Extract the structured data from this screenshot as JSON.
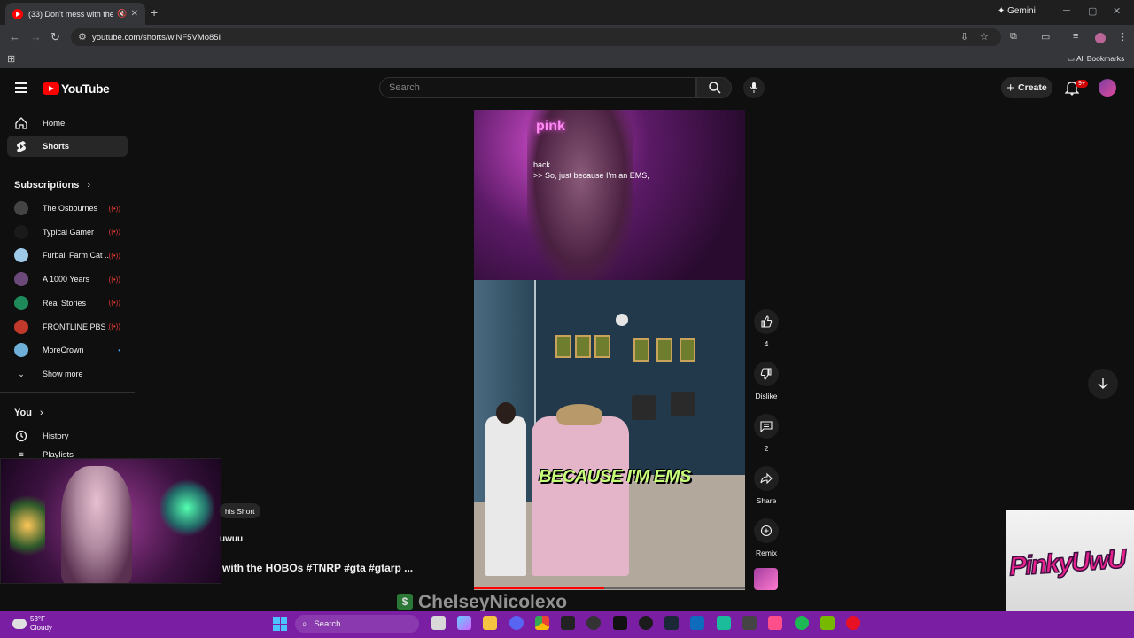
{
  "browser": {
    "tab_title": "(33) Don't mess with the H",
    "tab_mute": "🔇",
    "new_tab": "+",
    "gemini": "✦ Gemini",
    "url": "youtube.com/shorts/wiNF5VMo85I",
    "all_bookmarks": "All Bookmarks"
  },
  "youtube": {
    "logo_text": "YouTube",
    "search_placeholder": "Search",
    "create_label": "Create",
    "notification_badge": "9+"
  },
  "sidebar": {
    "home": "Home",
    "shorts": "Shorts",
    "subscriptions_title": "Subscriptions",
    "subscriptions": [
      {
        "name": "The Osbournes",
        "color": "#444444"
      },
      {
        "name": "Typical Gamer",
        "color": "#1a1a1a"
      },
      {
        "name": "Furball Farm Cat ...",
        "color": "#9ec9e8"
      },
      {
        "name": "A 1000 Years",
        "color": "#6b4a7a"
      },
      {
        "name": "Real Stories",
        "color": "#1e8a5a"
      },
      {
        "name": "FRONTLINE PBS ...",
        "color": "#c0392b"
      },
      {
        "name": "MoreCrown",
        "color": "#6fb0d8"
      }
    ],
    "show_more": "Show more",
    "you_title": "You",
    "history": "History",
    "playlists_partial": "Playlists"
  },
  "video": {
    "caption_line1": "back.",
    "caption_line2": ">> So, just because I'm an EMS,",
    "neon_sign": "pink",
    "burned_caption": "BECAUSE I'M EMS",
    "progress_fraction": 0.48
  },
  "actions": {
    "like_count": "4",
    "dislike_label": "Dislike",
    "comment_count": "2",
    "share_label": "Share",
    "remix_label": "Remix"
  },
  "overlay": {
    "short_label_fragment": "his Short",
    "author_fragment": "uwuu",
    "title_fragment": "with the HOBOs #TNRP #gta #gtarp ...",
    "watermark": "ChelseyNicolexo",
    "watermark_badge": "$",
    "brand_logo": "PinkyUwU"
  },
  "taskbar": {
    "temperature": "53°F",
    "condition": "Cloudy",
    "search": "Search"
  }
}
